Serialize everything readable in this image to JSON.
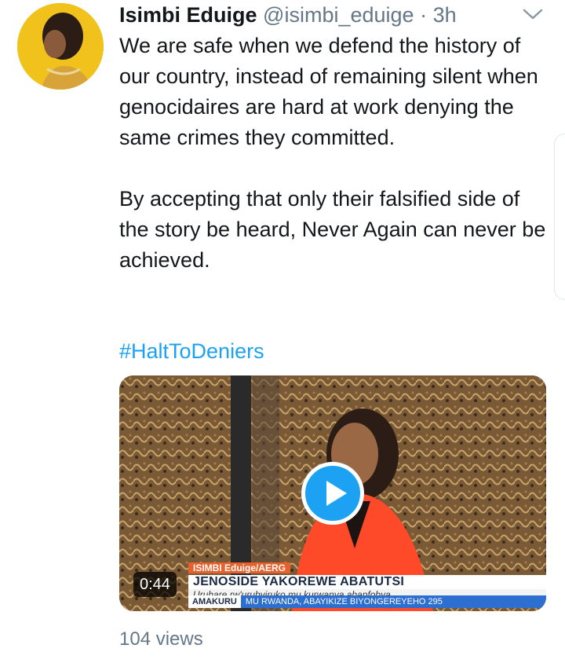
{
  "tweet": {
    "author_name": "Isimbi Eduige",
    "handle": "@isimbi_eduige",
    "separator": "·",
    "time": "3h",
    "paragraphs": [
      "We are safe when we defend the history of our country, instead of remaining silent when genocidaires are hard at work denying the same crimes they committed.",
      "By accepting that only their falsified side of the story be heard, Never Again can never be achieved."
    ],
    "hashtag": "#HaltToDeniers",
    "views": "104 views"
  },
  "video": {
    "duration": "0:44",
    "lower_third_tag": "ISIMBI Eduige/AERG",
    "headline": "JENOSIDE YAKOREWE ABATUTSI",
    "subline": "Uruhare rw'urubyiruko mu kurwanya abapfobya",
    "ticker_label": "AMAKURU",
    "ticker_text": "MU RWANDA, ABAYIKIZE BIYONGEREYEHO 295"
  },
  "icons": {
    "menu": "chevron-down-icon",
    "play": "play-icon"
  },
  "colors": {
    "link": "#1da1f2",
    "secondary_text": "#657786",
    "primary_text": "#14171a"
  }
}
